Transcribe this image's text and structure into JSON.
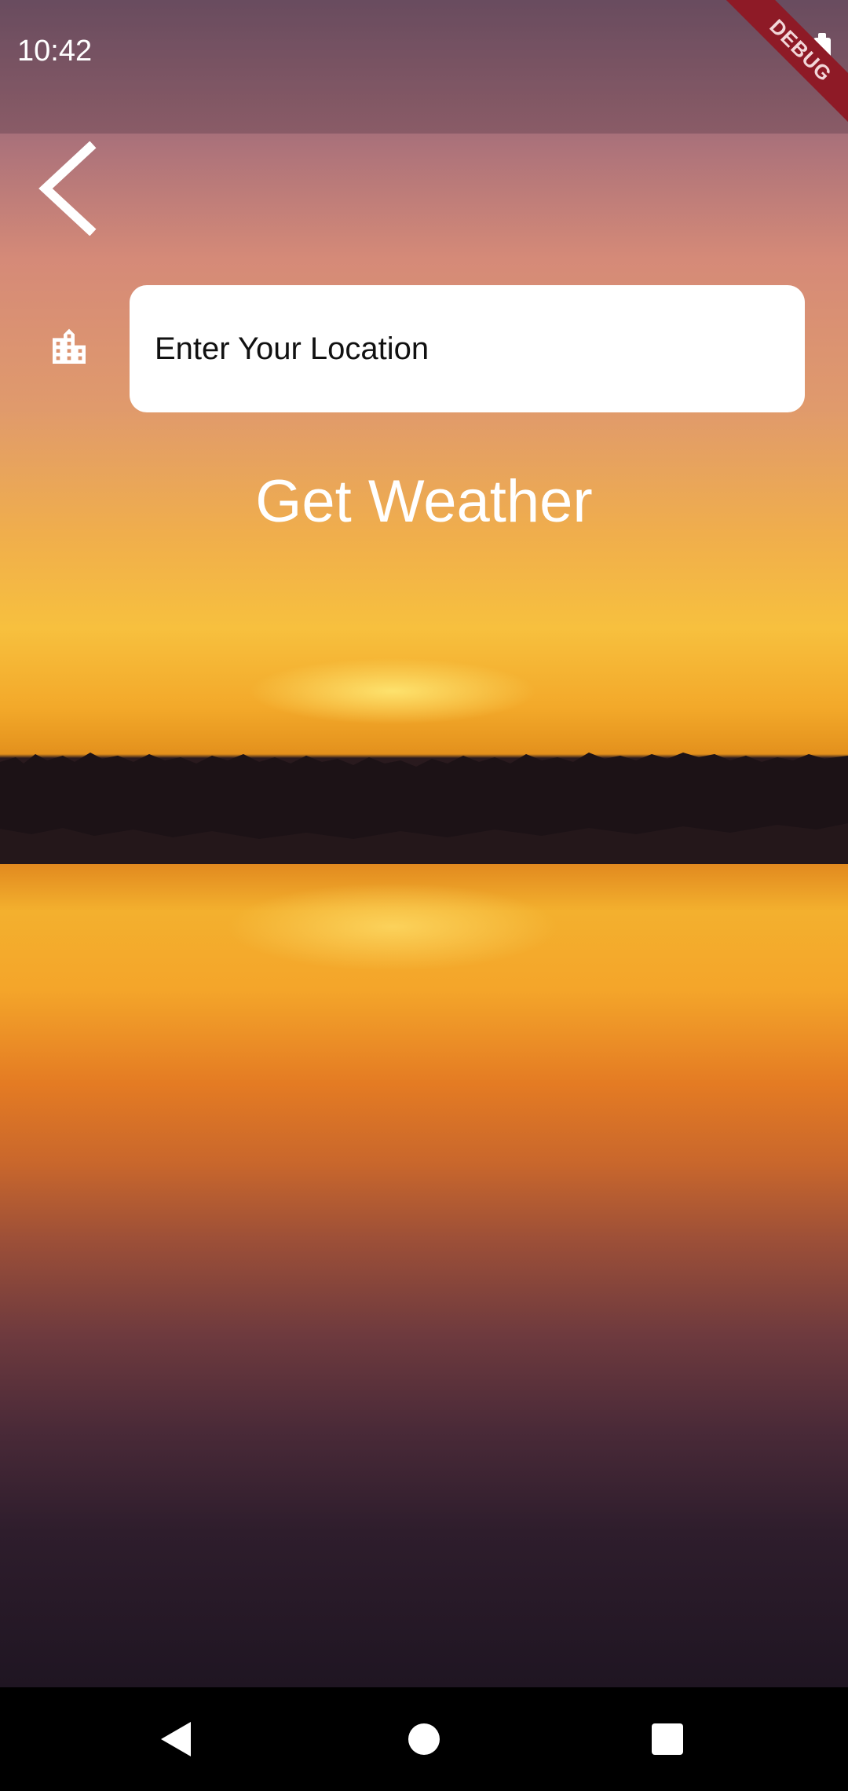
{
  "status_bar": {
    "time": "10:42",
    "debug_banner": "DEBUG"
  },
  "form": {
    "location_placeholder": "Enter Your Location",
    "location_value": "",
    "submit_label": "Get Weather"
  },
  "icons": {
    "back": "arrow-back-ios-icon",
    "city": "location-city-icon",
    "battery": "battery-full-icon"
  },
  "navigation": {
    "back": "nav-back-icon",
    "home": "nav-home-icon",
    "recents": "nav-recents-icon"
  },
  "colors": {
    "input_background": "#ffffff",
    "debug_ribbon": "#8e1a26",
    "nav_bar": "#000000",
    "text_light": "#ffffff"
  }
}
